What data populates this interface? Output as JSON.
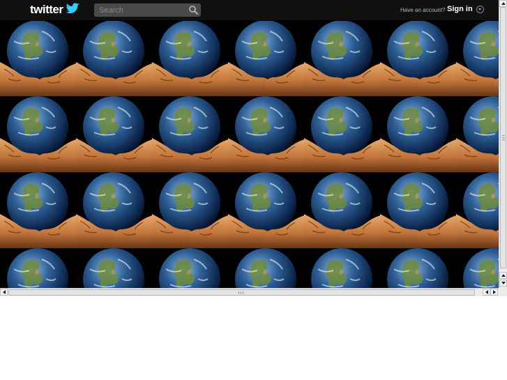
{
  "header": {
    "logo_text": "twitter",
    "search_placeholder": "Search",
    "have_account": "Have an account?",
    "signin_label": "Sign in"
  },
  "background": {
    "tile_image": "earth-in-hands-image",
    "columns": 7,
    "rows": 4
  },
  "colors": {
    "topbar": "#101010",
    "accent": "#33ccff",
    "search_bg": "#4a4a4a"
  }
}
